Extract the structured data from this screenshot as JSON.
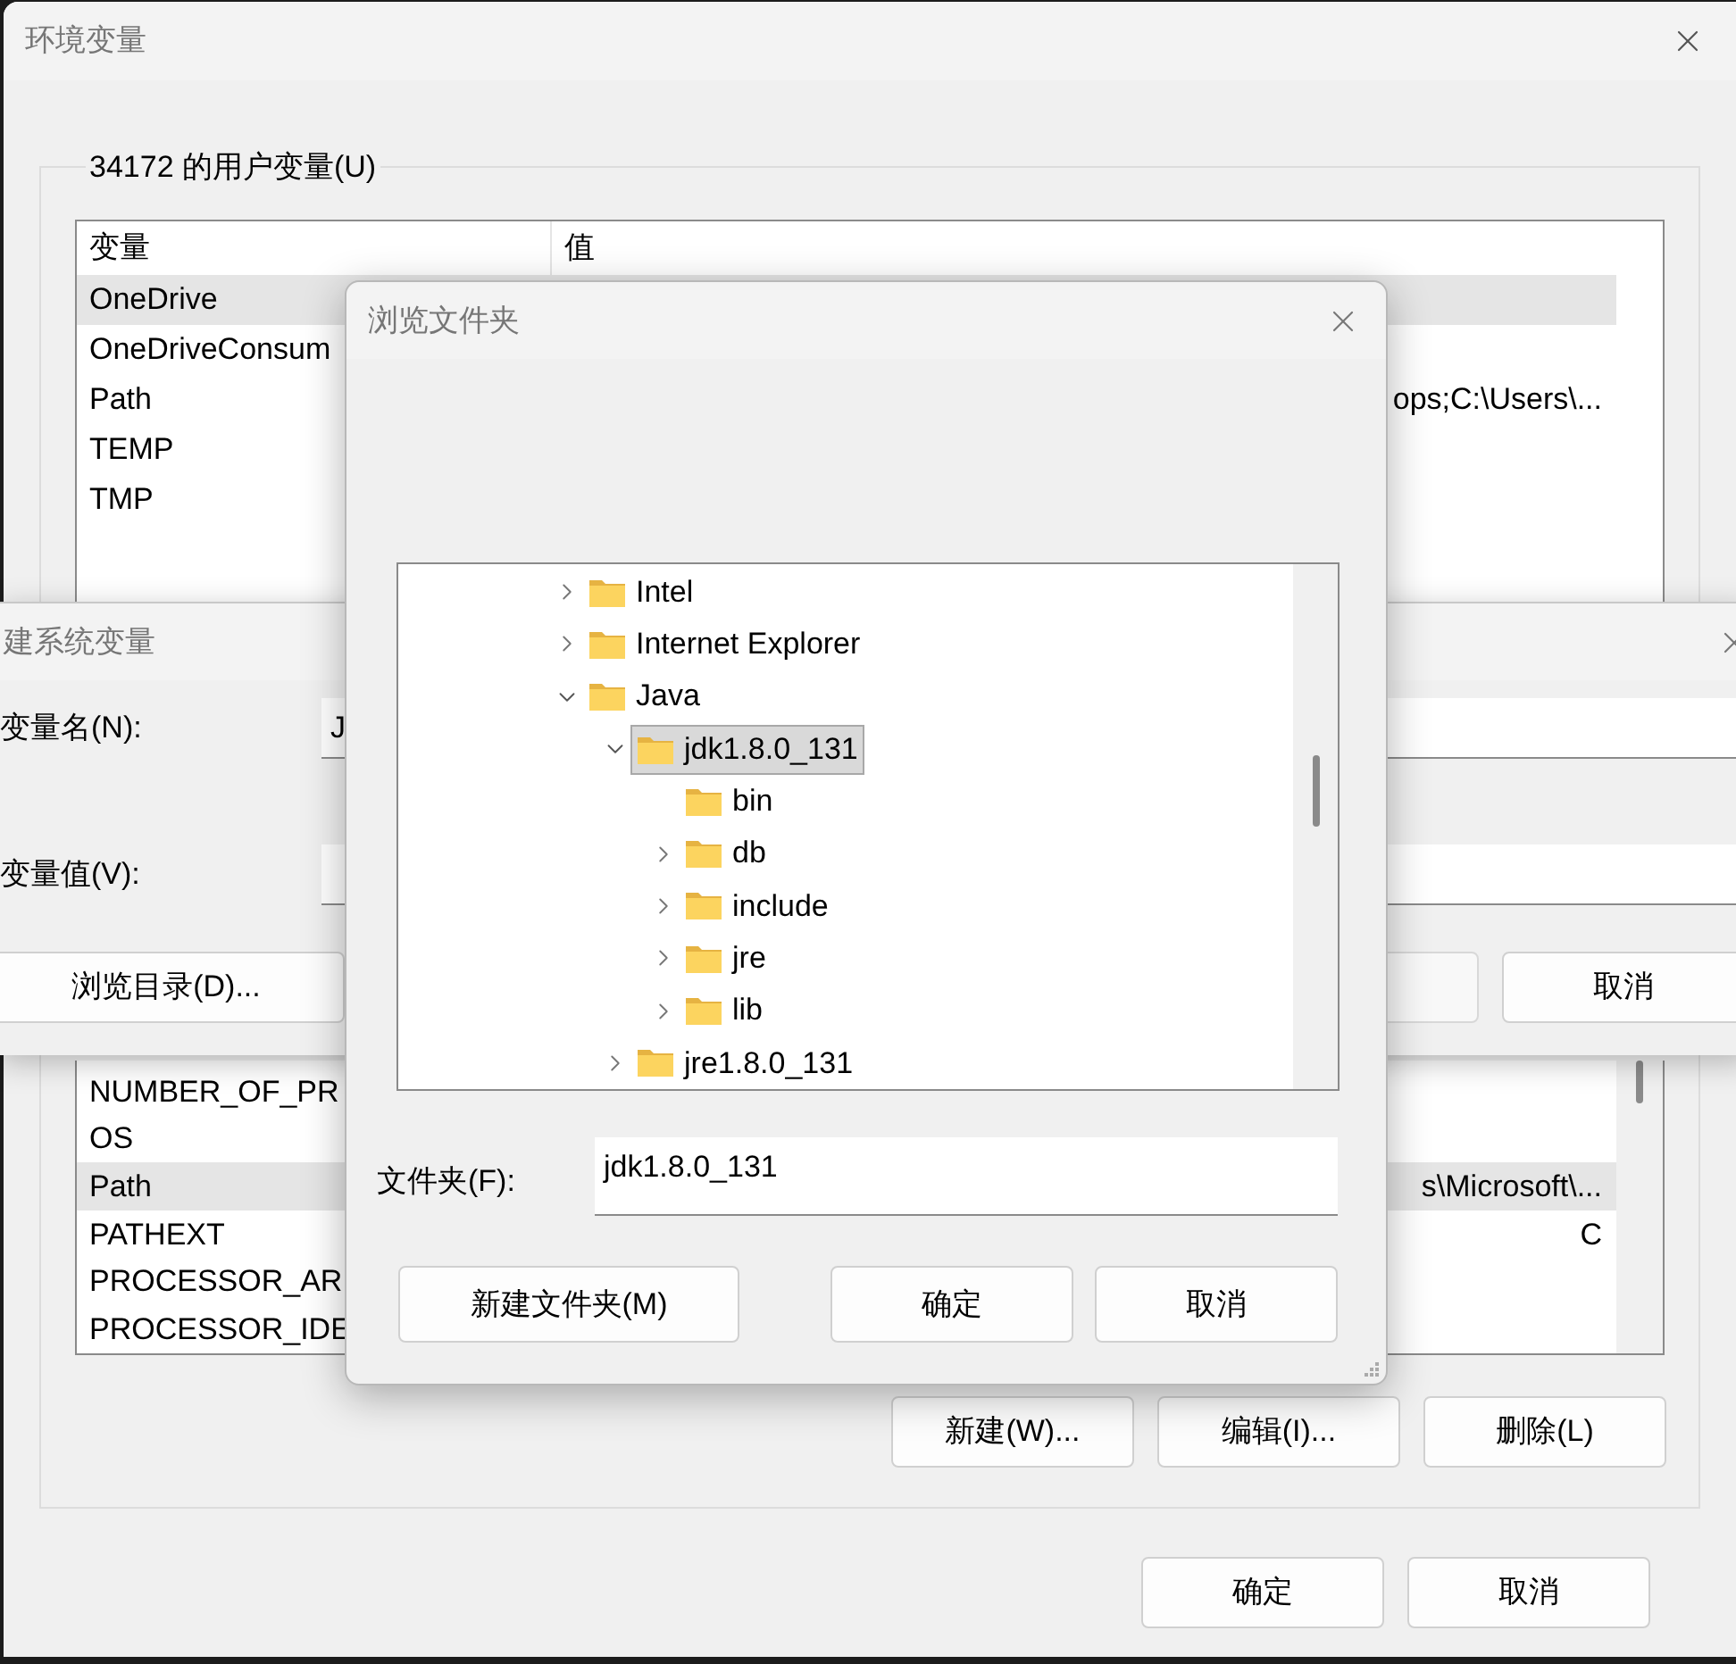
{
  "main_window": {
    "title": "环境变量",
    "user_vars": {
      "title": "34172 的用户变量(U)",
      "columns": [
        "变量",
        "值"
      ],
      "rows": [
        {
          "name": "OneDrive",
          "selected": true
        },
        {
          "name": "OneDriveConsum",
          "selected": false
        },
        {
          "name": "Path",
          "value": "ops;C:\\Users\\...",
          "selected": false
        },
        {
          "name": "TEMP",
          "selected": false
        },
        {
          "name": "TMP",
          "selected": false
        }
      ]
    },
    "system_vars": {
      "rows": [
        {
          "name": "NUMBER_OF_PR",
          "selected": false
        },
        {
          "name": "OS",
          "selected": false
        },
        {
          "name": "Path",
          "value": "s\\Microsoft\\...",
          "selected": true
        },
        {
          "name": "PATHEXT",
          "value": "C",
          "selected": false
        },
        {
          "name": "PROCESSOR_AR",
          "selected": false
        },
        {
          "name": "PROCESSOR_IDE",
          "selected": false
        }
      ],
      "buttons": [
        "新建(W)...",
        "编辑(I)...",
        "删除(L)"
      ]
    },
    "buttons": [
      "确定",
      "取消"
    ]
  },
  "new_var_dialog": {
    "title": "建系统变量",
    "fields": [
      {
        "label": "变量名(N):",
        "value": "J"
      },
      {
        "label": "变量值(V):"
      }
    ],
    "browse_button": "浏览目录(D)...",
    "cancel_button": "取消"
  },
  "browse_dialog": {
    "title": "浏览文件夹",
    "tree": [
      {
        "label": "Intel",
        "expanded": false,
        "selected": false
      },
      {
        "label": "Internet Explorer",
        "expanded": false,
        "selected": false
      },
      {
        "label": "Java",
        "expanded": true,
        "selected": false,
        "children": [
          {
            "label": "jdk1.8.0_131",
            "expanded": true,
            "selected": true,
            "children": [
              {
                "label": "bin",
                "selected": false
              },
              {
                "label": "db",
                "expanded": false,
                "selected": false
              },
              {
                "label": "include",
                "expanded": false,
                "selected": false
              },
              {
                "label": "jre",
                "expanded": false,
                "selected": false
              },
              {
                "label": "lib",
                "expanded": false,
                "selected": false
              }
            ]
          },
          {
            "label": "jre1.8.0_131",
            "expanded": false,
            "selected": false
          }
        ]
      }
    ],
    "folder_label": "文件夹(F):",
    "folder_value": "jdk1.8.0_131",
    "buttons": [
      "新建文件夹(M)",
      "确定",
      "取消"
    ]
  }
}
